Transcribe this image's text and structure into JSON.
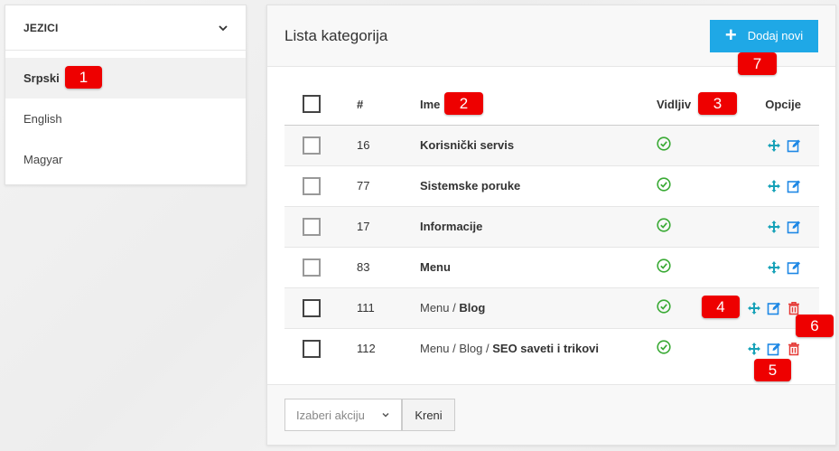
{
  "languages": {
    "header": "JEZICI",
    "items": [
      {
        "label": "Srpski",
        "active": true
      },
      {
        "label": "English",
        "active": false
      },
      {
        "label": "Magyar",
        "active": false
      }
    ]
  },
  "main": {
    "title": "Lista kategorija",
    "add_button": "Dodaj novi",
    "columns": {
      "num": "#",
      "name": "Ime",
      "visible": "Vidljiv",
      "options": "Opcije"
    },
    "rows": [
      {
        "id": "16",
        "path": "",
        "name": "Korisnički servis",
        "visible": true,
        "delete": false
      },
      {
        "id": "77",
        "path": "",
        "name": "Sistemske poruke",
        "visible": true,
        "delete": false
      },
      {
        "id": "17",
        "path": "",
        "name": "Informacije",
        "visible": true,
        "delete": false
      },
      {
        "id": "83",
        "path": "",
        "name": "Menu",
        "visible": true,
        "delete": false
      },
      {
        "id": "111",
        "path": "Menu /",
        "name": "Blog",
        "visible": true,
        "delete": true
      },
      {
        "id": "112",
        "path": "Menu / Blog /",
        "name": "SEO saveti i trikovi",
        "visible": true,
        "delete": true
      }
    ],
    "action_select": "Izaberi akciju",
    "go_button": "Kreni"
  },
  "badges": [
    "1",
    "2",
    "3",
    "4",
    "5",
    "6",
    "7"
  ],
  "colors": {
    "accent": "#1fa8e6",
    "check": "#3aaa35",
    "move": "#17a2b8",
    "edit": "#1e88e5",
    "delete": "#e53935",
    "badge": "#ee0000"
  },
  "icons": {
    "chevron": "chevron-down-icon",
    "add": "plus-icon",
    "visible": "check-circle-icon",
    "move": "move-icon",
    "edit": "edit-icon",
    "delete": "trash-icon",
    "select_caret": "chevron-down-icon"
  }
}
